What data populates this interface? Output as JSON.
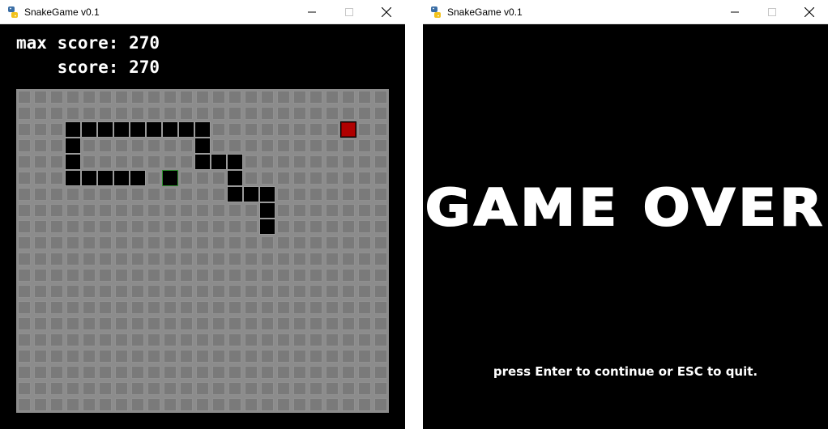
{
  "windows": [
    {
      "title": "SnakeGame v0.1",
      "hud": {
        "max_score_label": "max score:",
        "max_score": "270",
        "score_label": "score:",
        "score": "270"
      },
      "board": {
        "cols": 23,
        "rows": 20,
        "snake_cells": [
          [
            3,
            2
          ],
          [
            4,
            2
          ],
          [
            5,
            2
          ],
          [
            6,
            2
          ],
          [
            7,
            2
          ],
          [
            8,
            2
          ],
          [
            9,
            2
          ],
          [
            10,
            2
          ],
          [
            11,
            2
          ],
          [
            3,
            3
          ],
          [
            11,
            3
          ],
          [
            3,
            4
          ],
          [
            11,
            4
          ],
          [
            12,
            4
          ],
          [
            13,
            4
          ],
          [
            3,
            5
          ],
          [
            4,
            5
          ],
          [
            5,
            5
          ],
          [
            6,
            5
          ],
          [
            7,
            5
          ],
          [
            13,
            5
          ],
          [
            13,
            6
          ],
          [
            14,
            6
          ],
          [
            15,
            6
          ],
          [
            15,
            7
          ],
          [
            15,
            8
          ]
        ],
        "snake_head": [
          9,
          5
        ],
        "food": [
          20,
          2
        ]
      }
    },
    {
      "title": "SnakeGame v0.1",
      "game_over_text": "GAME OVER",
      "hint_text": "press Enter to continue or ESC to quit."
    }
  ],
  "colors": {
    "board_bg": "#808080",
    "snake_body": "#000000",
    "snake_head_border": "#2f8f2f",
    "food": "#b00000"
  },
  "icons": {
    "app": "python-snake-icon",
    "minimize": "minimize-icon",
    "maximize": "maximize-icon",
    "close": "close-icon"
  }
}
